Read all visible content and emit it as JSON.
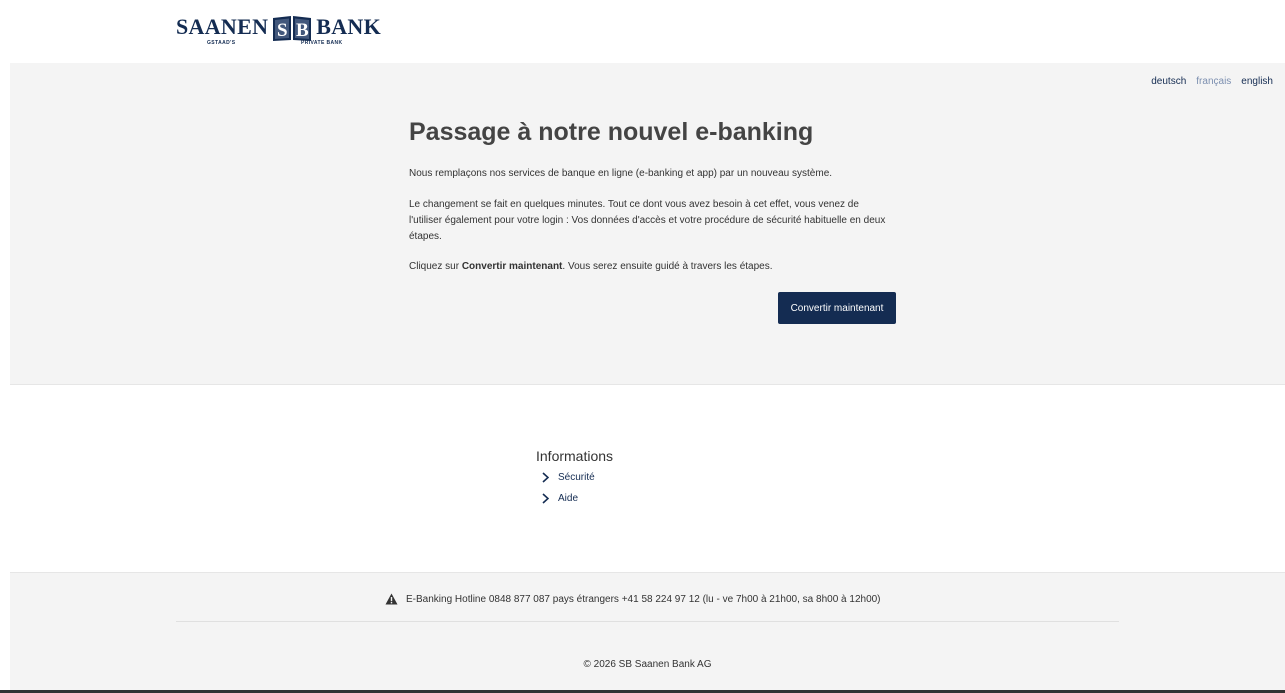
{
  "logo": {
    "left_word": "SAANEN",
    "right_word": "BANK",
    "sub_left": "GSTAAD'S",
    "sub_right": "PRIVATE BANK",
    "brand_color": "#142c52"
  },
  "languages": [
    {
      "label": "deutsch",
      "active": false
    },
    {
      "label": "français",
      "active": true
    },
    {
      "label": "english",
      "active": false
    }
  ],
  "main": {
    "title": "Passage à notre nouvel e-banking",
    "paragraph1": "Nous remplaçons nos services de banque en ligne (e-banking et app) par un nouveau système.",
    "paragraph2": "Le changement se fait en quelques minutes. Tout ce dont vous avez besoin à cet effet, vous venez de l'utiliser également pour votre login : Vos données d'accès et votre procédure de sécurité habituelle en deux étapes.",
    "paragraph3_prefix": "Cliquez sur ",
    "paragraph3_bold": "Convertir maintenant",
    "paragraph3_suffix": ". Vous serez ensuite guidé à travers les étapes.",
    "button_label": "Convertir maintenant"
  },
  "info": {
    "title": "Informations",
    "links": [
      "Sécurité",
      "Aide"
    ]
  },
  "footer": {
    "hotline": "E-Banking Hotline 0848 877 087 pays étrangers +41 58 224 97 12 (lu - ve 7h00 à 21h00, sa 8h00 à 12h00)",
    "copyright": "© 2026 SB Saanen Bank AG"
  },
  "icons": [
    "warning-icon",
    "chevron-right-icon"
  ]
}
